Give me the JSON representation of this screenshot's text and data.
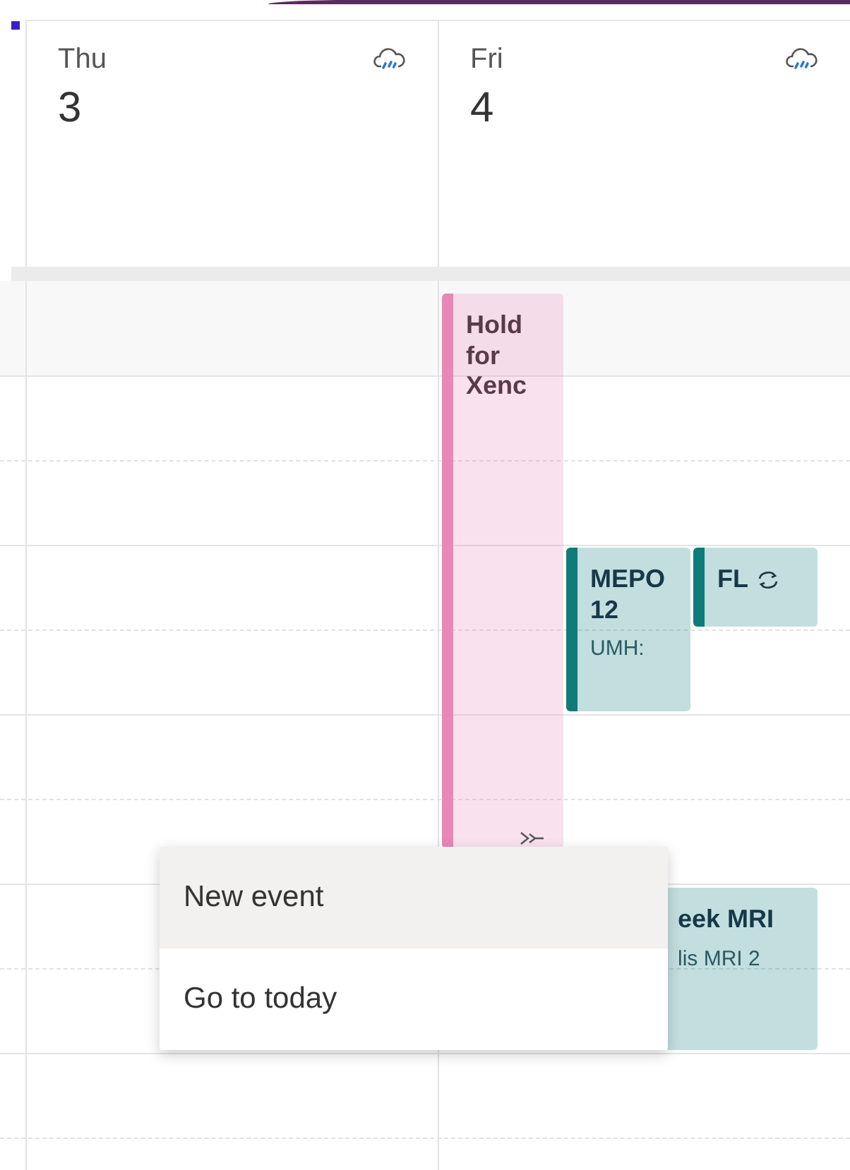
{
  "days": [
    {
      "name": "Thu",
      "date": "3"
    },
    {
      "name": "Fri",
      "date": "4"
    }
  ],
  "events": [
    {
      "title": "Hold for Xenc",
      "color": "#e887b8"
    },
    {
      "title": "MEPO 12",
      "subtitle": "UMH:",
      "color": "#0f7b7b"
    },
    {
      "title": "FL",
      "color": "#0f7b7b"
    },
    {
      "title": "eek MRI",
      "subtitle": "lis MRI 2"
    }
  ],
  "context_menu": {
    "items": [
      {
        "label": "New event",
        "selected": true
      },
      {
        "label": "Go to today",
        "selected": false
      }
    ]
  }
}
